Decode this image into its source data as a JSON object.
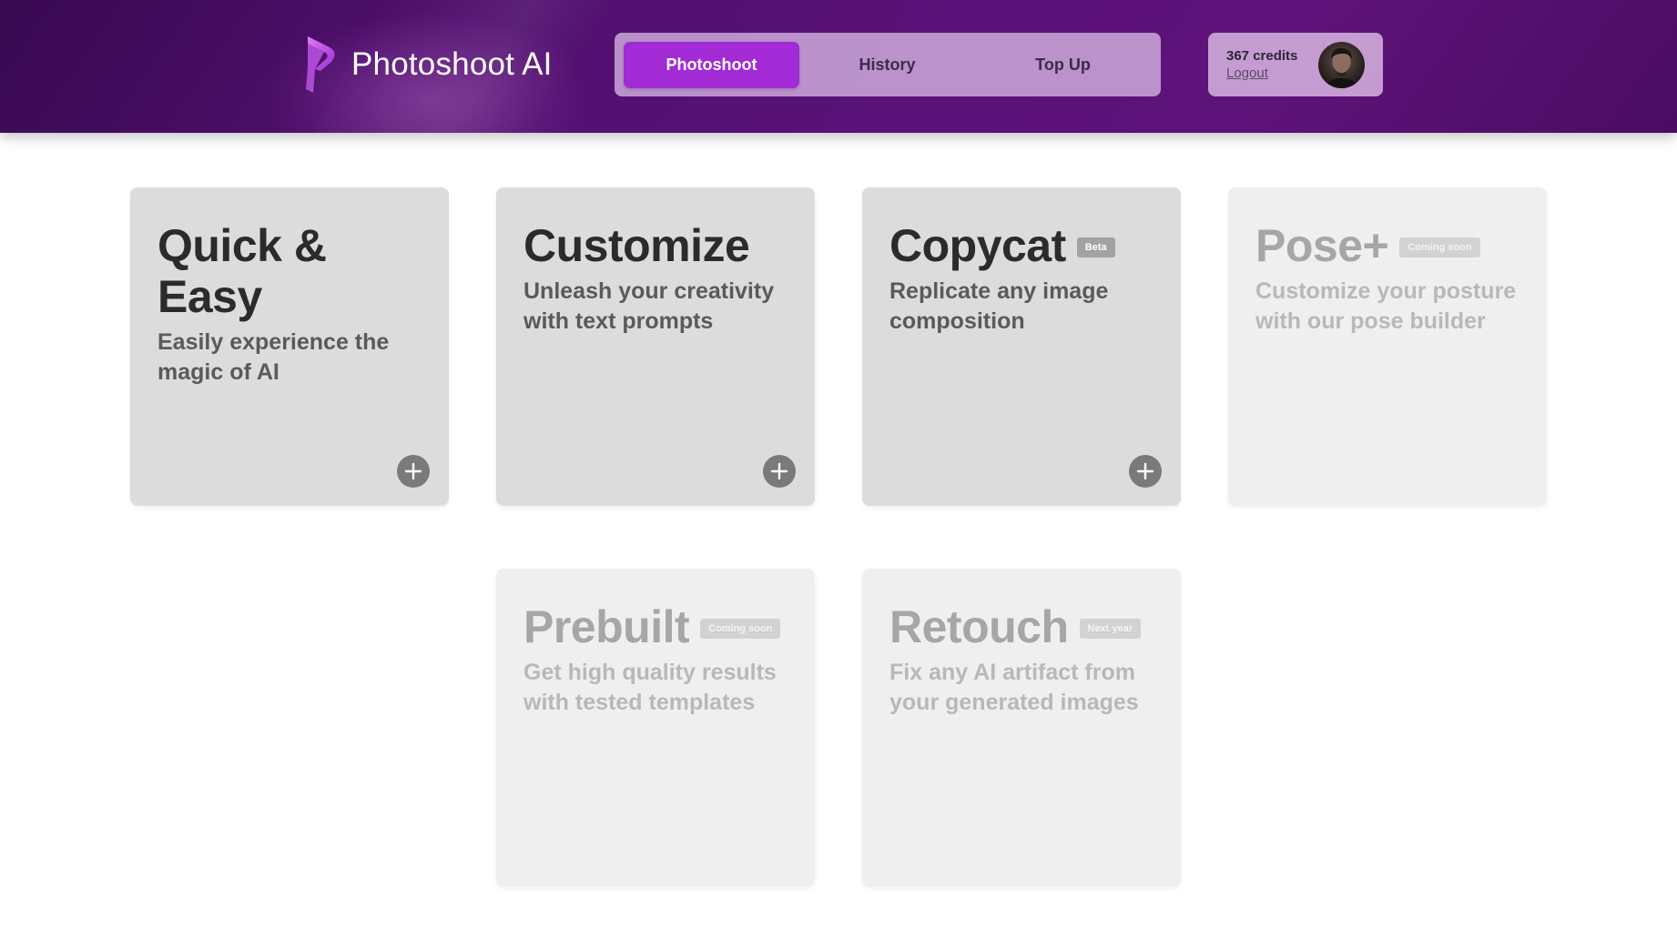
{
  "app": {
    "name": "Photoshoot AI"
  },
  "nav": {
    "tabs": [
      {
        "label": "Photoshoot",
        "active": true
      },
      {
        "label": "History",
        "active": false
      },
      {
        "label": "Top Up",
        "active": false
      }
    ]
  },
  "account": {
    "credits": "367 credits",
    "logout": "Logout"
  },
  "cards": [
    {
      "title": "Quick & Easy",
      "badge": "",
      "description": "Easily experience the magic of AI",
      "enabled": true
    },
    {
      "title": "Customize",
      "badge": "",
      "description": "Unleash your creativity with text prompts",
      "enabled": true
    },
    {
      "title": "Copycat",
      "badge": "Beta",
      "description": "Replicate any image composition",
      "enabled": true
    },
    {
      "title": "Pose+",
      "badge": "Coming soon",
      "description": "Customize your posture with our pose builder",
      "enabled": false
    },
    {
      "title": "Prebuilt",
      "badge": "Coming soon",
      "description": "Get high quality results with tested templates",
      "enabled": false
    },
    {
      "title": "Retouch",
      "badge": "Next year",
      "description": "Fix any AI artifact from your generated images",
      "enabled": false
    }
  ],
  "colors": {
    "header": "#4f0f6e",
    "active_tab": "#a22bd6",
    "card": "#dcdcdc",
    "card_disabled": "#efefef",
    "plus_button": "#7a7a7a"
  },
  "icons": {
    "logo": "photoshoot-ai-logo-icon",
    "add": "plus-icon",
    "avatar": "user-avatar"
  }
}
